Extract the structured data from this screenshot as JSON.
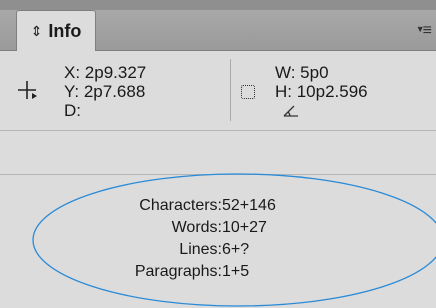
{
  "panel": {
    "tab_label": "Info",
    "tab_arrows_icon": "up-down-arrows-icon",
    "menu_icon": "panel-menu-icon"
  },
  "position": {
    "x": "X: 2p9.327",
    "y": "Y: 2p7.688",
    "d": "D:"
  },
  "size": {
    "w": "W: 5p0",
    "h": "H: 10p2.596"
  },
  "stats": [
    {
      "label": "Characters:",
      "value": "52+146"
    },
    {
      "label": "Words:",
      "value": "10+27"
    },
    {
      "label": "Lines:",
      "value": "6+?"
    },
    {
      "label": "Paragraphs:",
      "value": "1+5"
    }
  ],
  "annotation_color": "#2a8ad6"
}
